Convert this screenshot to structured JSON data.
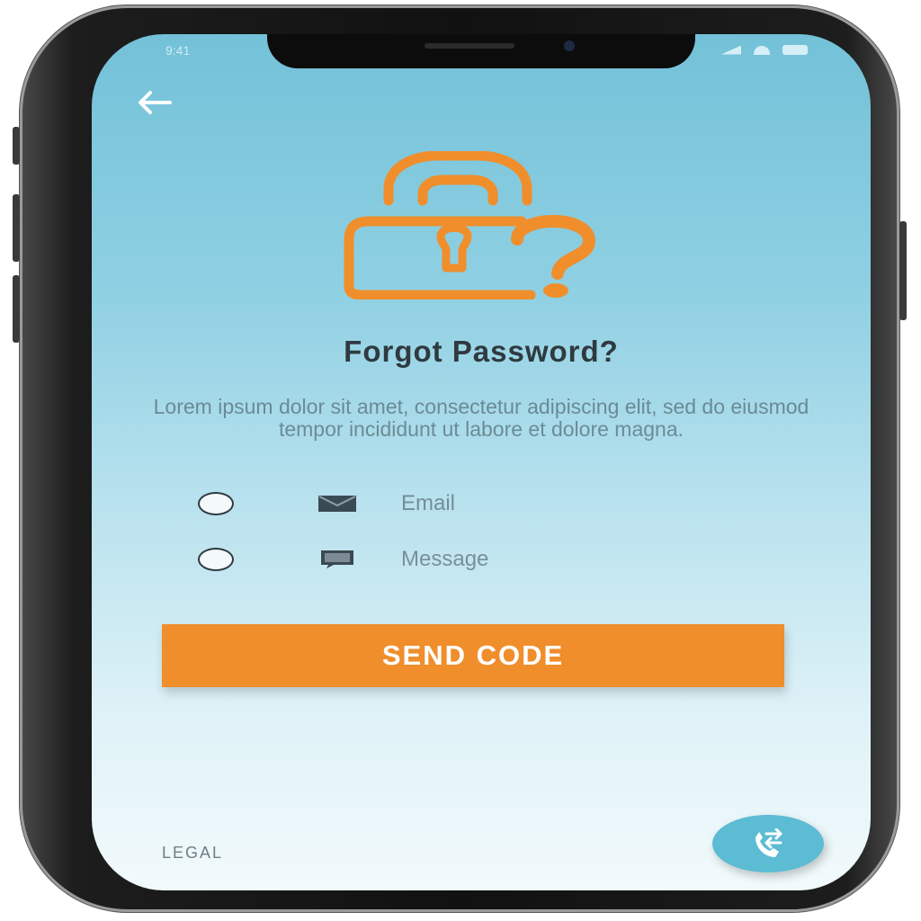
{
  "status_bar": {
    "time": "9:41"
  },
  "header": {
    "back_icon": "arrow-left-icon"
  },
  "illustration": {
    "icon": "padlock-question-icon",
    "color": "#f08e2c"
  },
  "content": {
    "title": "Forgot Password?",
    "description": "Lorem ipsum dolor sit amet, consectetur adipiscing elit, sed do eiusmod tempor incididunt ut labore et dolore magna."
  },
  "options": [
    {
      "label": "Email",
      "icon": "envelope-icon",
      "selected": false
    },
    {
      "label": "Message",
      "icon": "message-icon",
      "selected": false
    }
  ],
  "actions": {
    "send_label": "SEND CODE"
  },
  "footer": {
    "legal_label": "LEGAL",
    "fab_icon": "call-transfer-icon"
  },
  "colors": {
    "accent": "#f08e2c",
    "background_top": "#73c1d8",
    "background_bottom": "#f2fafc",
    "fab": "#5bbcd4",
    "text_dark": "#2f3a40"
  }
}
